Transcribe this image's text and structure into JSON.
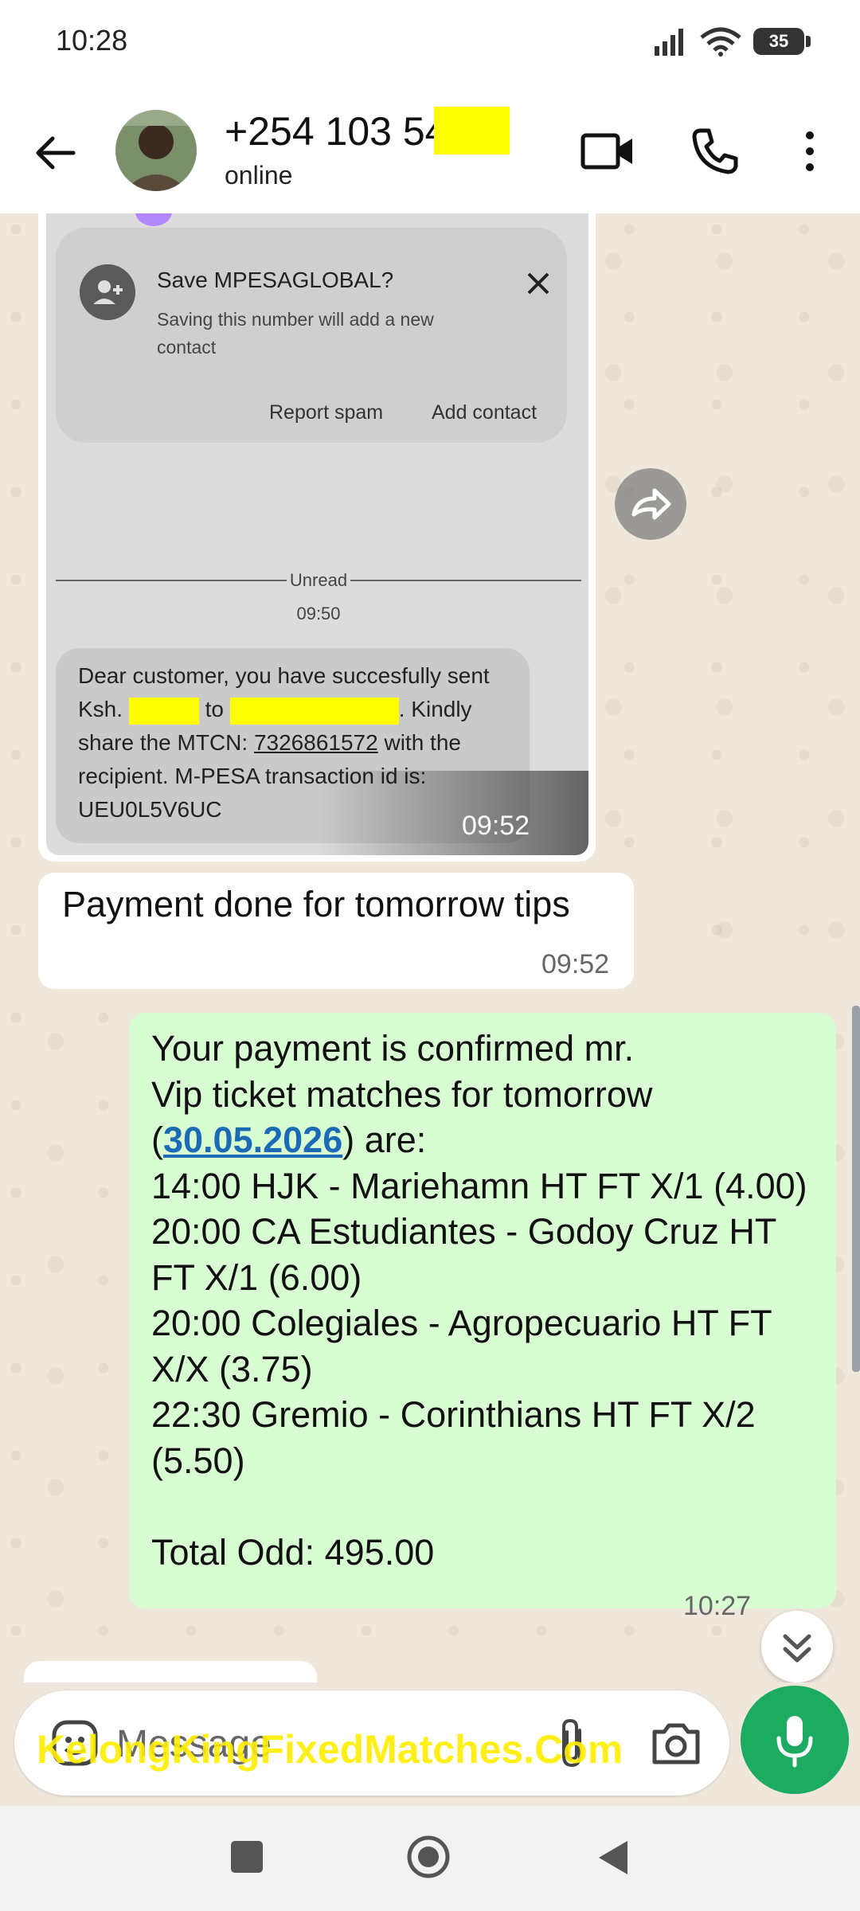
{
  "status_bar": {
    "time": "10:28",
    "battery": "35",
    "icons": [
      "signal-icon",
      "wifi-icon",
      "battery-icon"
    ]
  },
  "header": {
    "contact_name": "+254 103 54   95",
    "status": "online",
    "icons": [
      "back-arrow-icon",
      "video-call-icon",
      "phone-icon",
      "more-vert-icon"
    ]
  },
  "image_message": {
    "save_prompt_title": "Save MPESAGLOBAL?",
    "save_prompt_desc": "Saving this number will add a new contact",
    "report_spam": "Report spam",
    "add_contact": "Add contact",
    "unread_label": "Unread",
    "unread_time": "09:50",
    "sms": {
      "prefix": "Dear customer, you have succesfully sent Ksh.",
      "to": "to",
      "kindly": ". Kindly share the MTCN:",
      "mtcn": "7326861572",
      "suffix": "with the recipient. M-PESA transaction id is: UEU0L5V6UC"
    },
    "time": "09:52"
  },
  "incoming_message": {
    "text": "Payment done for tomorrow tips",
    "time": "09:52"
  },
  "outgoing_message": {
    "line1": "Your payment is confirmed mr.",
    "line2": "Vip ticket matches for tomorrow",
    "date_open": "(",
    "date": "30.05.2026",
    "date_close": ") are:",
    "match1": "14:00 HJK - Mariehamn HT FT X/1 (4.00)",
    "match2": "20:00 CA Estudiantes - Godoy Cruz HT FT X/1 (6.00)",
    "match3": "20:00 Colegiales - Agropecuario HT FT X/X (3.75)",
    "match4": "22:30 Gremio - Corinthians HT FT X/2 (5.50)",
    "total": "Total Odd: 495.00",
    "time": "10:27"
  },
  "composer": {
    "placeholder": "Message",
    "icons": [
      "sticker-icon",
      "attach-icon",
      "camera-icon",
      "mic-icon"
    ]
  },
  "watermark": "KelongKingFixedMatches.Com",
  "colors": {
    "outgoing_bubble": "#d9fdd3",
    "incoming_bubble": "#ffffff",
    "chat_background": "#efe7db",
    "mic_button": "#1daa61",
    "link": "#1b6ab5",
    "redaction": "#ffff00"
  }
}
